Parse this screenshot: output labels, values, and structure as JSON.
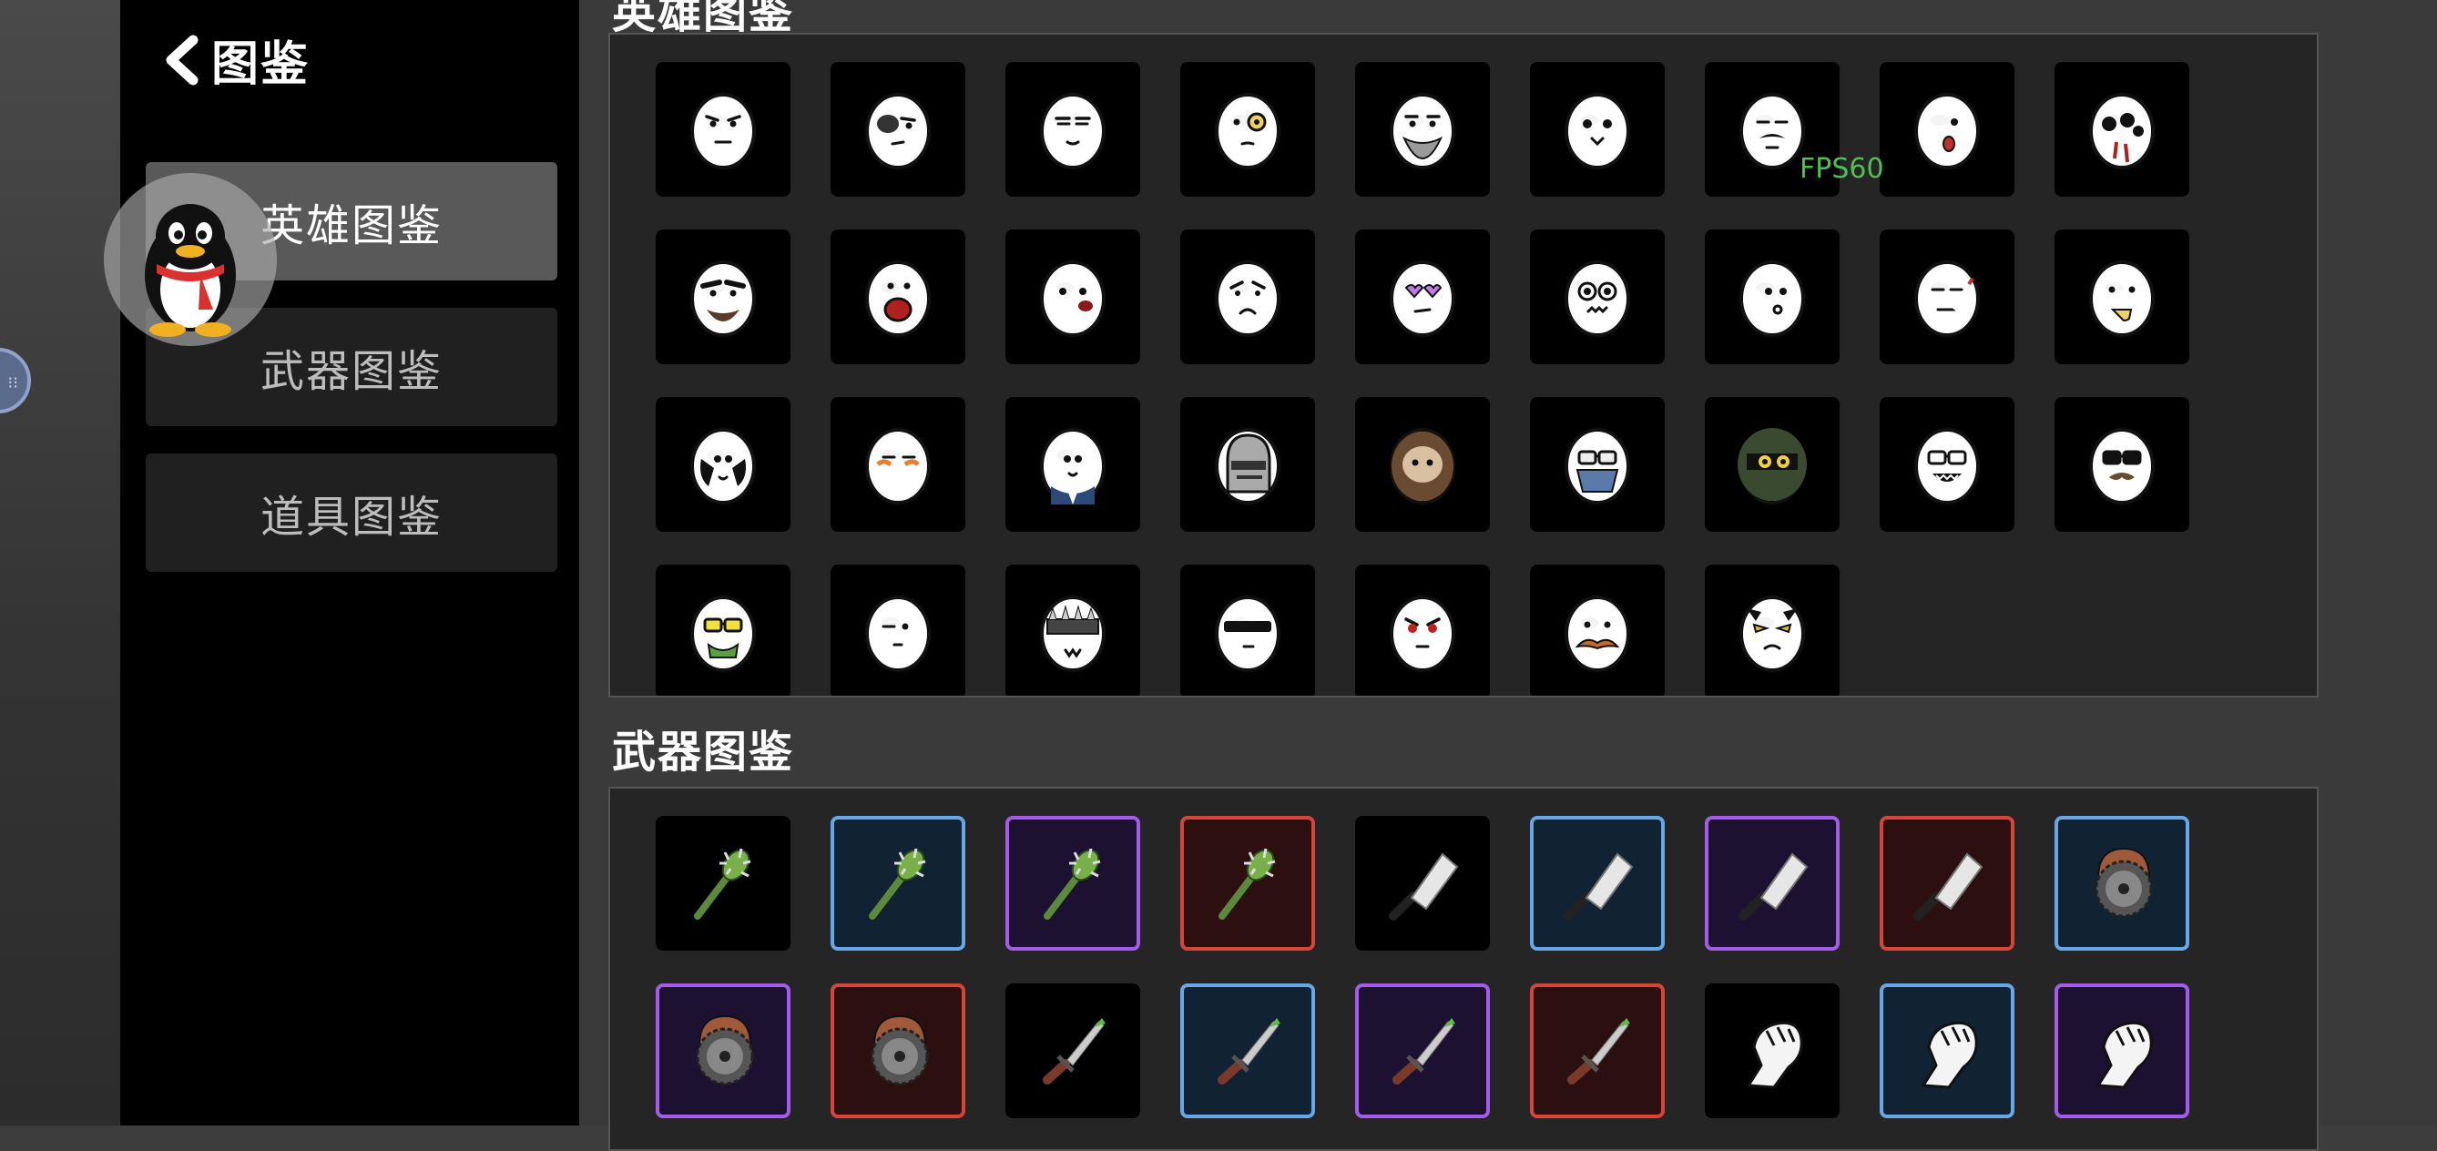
{
  "header": {
    "title": "图鉴",
    "back_icon": "chevron-left-icon"
  },
  "sidebar": {
    "items": [
      {
        "label": "英雄图鉴",
        "active": true
      },
      {
        "label": "武器图鉴",
        "active": false
      },
      {
        "label": "道具图鉴",
        "active": false
      }
    ]
  },
  "overlay": {
    "fps": "FPS60",
    "float_ball_icon": "assistive-ball-icon",
    "qq_icon": "qq-penguin-icon"
  },
  "sections": {
    "heroes": {
      "title": "英雄图鉴",
      "items": [
        "grumpy",
        "eyepatch",
        "sly",
        "monocle",
        "beard",
        "cute",
        "mustache",
        "dazed",
        "zombie",
        "hairy",
        "screaming",
        "blush",
        "sad",
        "heart-glasses",
        "nervous",
        "kiss",
        "smoking",
        "drool",
        "hands",
        "bandaged",
        "suit",
        "helmet",
        "hairy-man",
        "masked-glasses",
        "ninja",
        "nerd",
        "mustache-glasses",
        "shades-drool",
        "plain",
        "spiked",
        "visor",
        "angry",
        "long-mustache",
        "horned"
      ]
    },
    "weapons": {
      "title": "武器图鉴",
      "items": [
        {
          "icon": "spiked-club-icon",
          "rarity": "common"
        },
        {
          "icon": "spiked-club-icon",
          "rarity": "rare"
        },
        {
          "icon": "spiked-club-icon",
          "rarity": "epic"
        },
        {
          "icon": "spiked-club-icon",
          "rarity": "legendary"
        },
        {
          "icon": "cleaver-icon",
          "rarity": "common"
        },
        {
          "icon": "cleaver-icon",
          "rarity": "rare"
        },
        {
          "icon": "cleaver-icon",
          "rarity": "epic"
        },
        {
          "icon": "cleaver-icon",
          "rarity": "legendary"
        },
        {
          "icon": "saw-blade-icon",
          "rarity": "rare"
        },
        {
          "icon": "saw-blade-icon",
          "rarity": "epic"
        },
        {
          "icon": "saw-blade-icon",
          "rarity": "legendary"
        },
        {
          "icon": "dagger-icon",
          "rarity": "common"
        },
        {
          "icon": "dagger-icon",
          "rarity": "rare"
        },
        {
          "icon": "dagger-icon",
          "rarity": "epic"
        },
        {
          "icon": "dagger-icon",
          "rarity": "legendary"
        },
        {
          "icon": "fist-icon",
          "rarity": "common"
        },
        {
          "icon": "fist-icon",
          "rarity": "rare"
        },
        {
          "icon": "fist-icon",
          "rarity": "epic"
        }
      ]
    }
  },
  "colors": {
    "rarity_rare": "#67a7e8",
    "rarity_epic": "#a65ce8",
    "rarity_legendary": "#d9443a",
    "fps_text": "#4fc04f"
  }
}
